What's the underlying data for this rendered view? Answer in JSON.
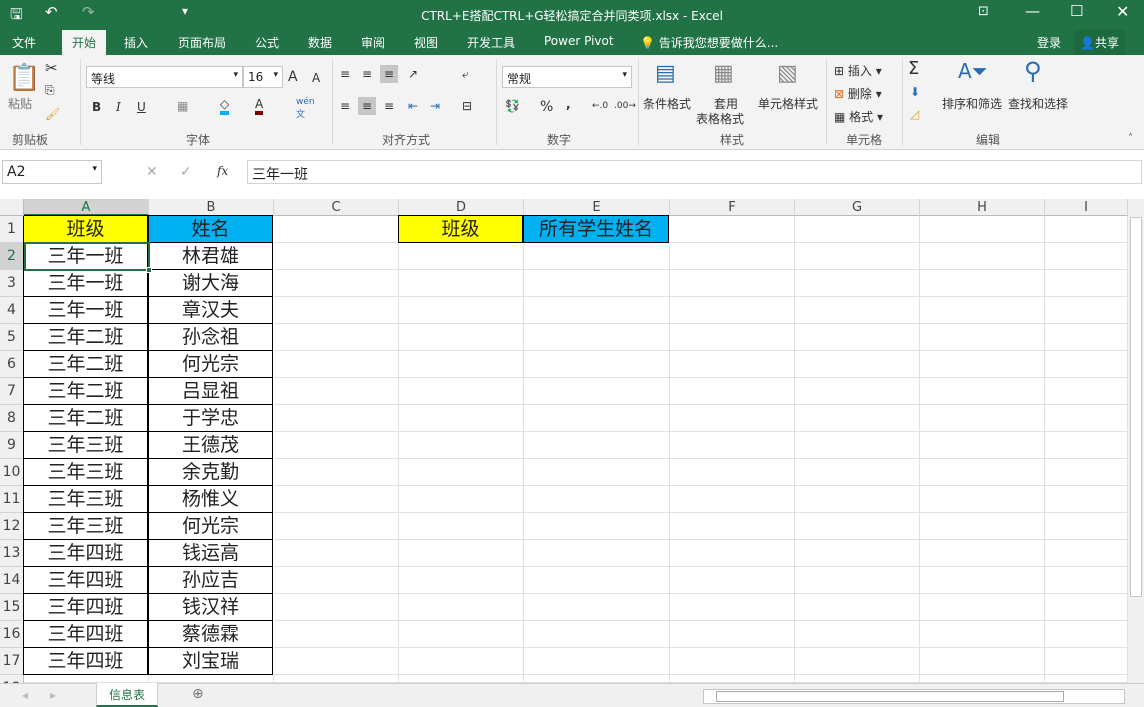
{
  "window": {
    "title": "CTRL+E搭配CTRL+G轻松搞定合并同类项.xlsx - Excel"
  },
  "tabs": [
    "文件",
    "开始",
    "插入",
    "页面布局",
    "公式",
    "数据",
    "审阅",
    "视图",
    "开发工具",
    "Power Pivot"
  ],
  "tell_me": "告诉我您想要做什么...",
  "login": "登录",
  "share": "共享",
  "ribbon": {
    "clipboard": {
      "paste": "粘贴",
      "label": "剪贴板"
    },
    "font": {
      "name": "等线",
      "size": "16",
      "label": "字体",
      "bold": "B",
      "italic": "I",
      "underline": "U"
    },
    "alignment": {
      "label": "对齐方式"
    },
    "number": {
      "format": "常规",
      "label": "数字",
      "percent": "%",
      "comma": ","
    },
    "styles": {
      "conditional": "条件格式",
      "table1": "套用",
      "table2": "表格格式",
      "cell": "单元格样式",
      "label": "样式"
    },
    "cells": {
      "insert": "插入",
      "delete": "删除",
      "format": "格式",
      "label": "单元格"
    },
    "editing": {
      "sort": "排序和筛选",
      "find": "查找和选择",
      "label": "编辑"
    }
  },
  "formula_bar": {
    "name_box": "A2",
    "fx": "fx",
    "value": "三年一班"
  },
  "columns": [
    "A",
    "B",
    "C",
    "D",
    "E",
    "F",
    "G",
    "H",
    "I"
  ],
  "colors": {
    "yellow": "#ffff00",
    "blue": "#00b0f0",
    "excel_green": "#217346"
  },
  "headers": {
    "A1": "班级",
    "B1": "姓名",
    "D1": "班级",
    "E1": "所有学生姓名"
  },
  "rows": [
    [
      "三年一班",
      "林君雄"
    ],
    [
      "三年一班",
      "谢大海"
    ],
    [
      "三年一班",
      "章汉夫"
    ],
    [
      "三年二班",
      "孙念祖"
    ],
    [
      "三年二班",
      "何光宗"
    ],
    [
      "三年二班",
      "吕显祖"
    ],
    [
      "三年二班",
      "于学忠"
    ],
    [
      "三年三班",
      "王德茂"
    ],
    [
      "三年三班",
      "余克勤"
    ],
    [
      "三年三班",
      "杨惟义"
    ],
    [
      "三年三班",
      "何光宗"
    ],
    [
      "三年四班",
      "钱运高"
    ],
    [
      "三年四班",
      "孙应吉"
    ],
    [
      "三年四班",
      "钱汉祥"
    ],
    [
      "三年四班",
      "蔡德霖"
    ],
    [
      "三年四班",
      "刘宝瑞"
    ]
  ],
  "sheet_tab": "信息表"
}
